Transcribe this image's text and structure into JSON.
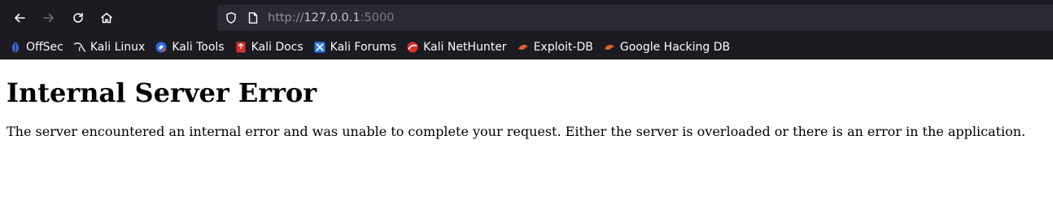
{
  "browser": {
    "url": {
      "scheme": "http://",
      "host": "127.0.0.1",
      "port": ":5000"
    },
    "bookmarks": [
      {
        "label": "OffSec",
        "icon": "offsec-icon"
      },
      {
        "label": "Kali Linux",
        "icon": "kali-dragon-icon"
      },
      {
        "label": "Kali Tools",
        "icon": "kali-tools-icon"
      },
      {
        "label": "Kali Docs",
        "icon": "kali-docs-icon"
      },
      {
        "label": "Kali Forums",
        "icon": "kali-forums-icon"
      },
      {
        "label": "Kali NetHunter",
        "icon": "kali-nethunter-icon"
      },
      {
        "label": "Exploit-DB",
        "icon": "exploit-db-icon"
      },
      {
        "label": "Google Hacking DB",
        "icon": "google-hacking-db-icon"
      }
    ],
    "colors": {
      "toolbar": "#1c1b22",
      "urlbar": "#2b2a33",
      "text": "#fbfbfe"
    }
  },
  "page": {
    "heading": "Internal Server Error",
    "message": "The server encountered an internal error and was unable to complete your request. Either the server is overloaded or there is an error in the application."
  }
}
